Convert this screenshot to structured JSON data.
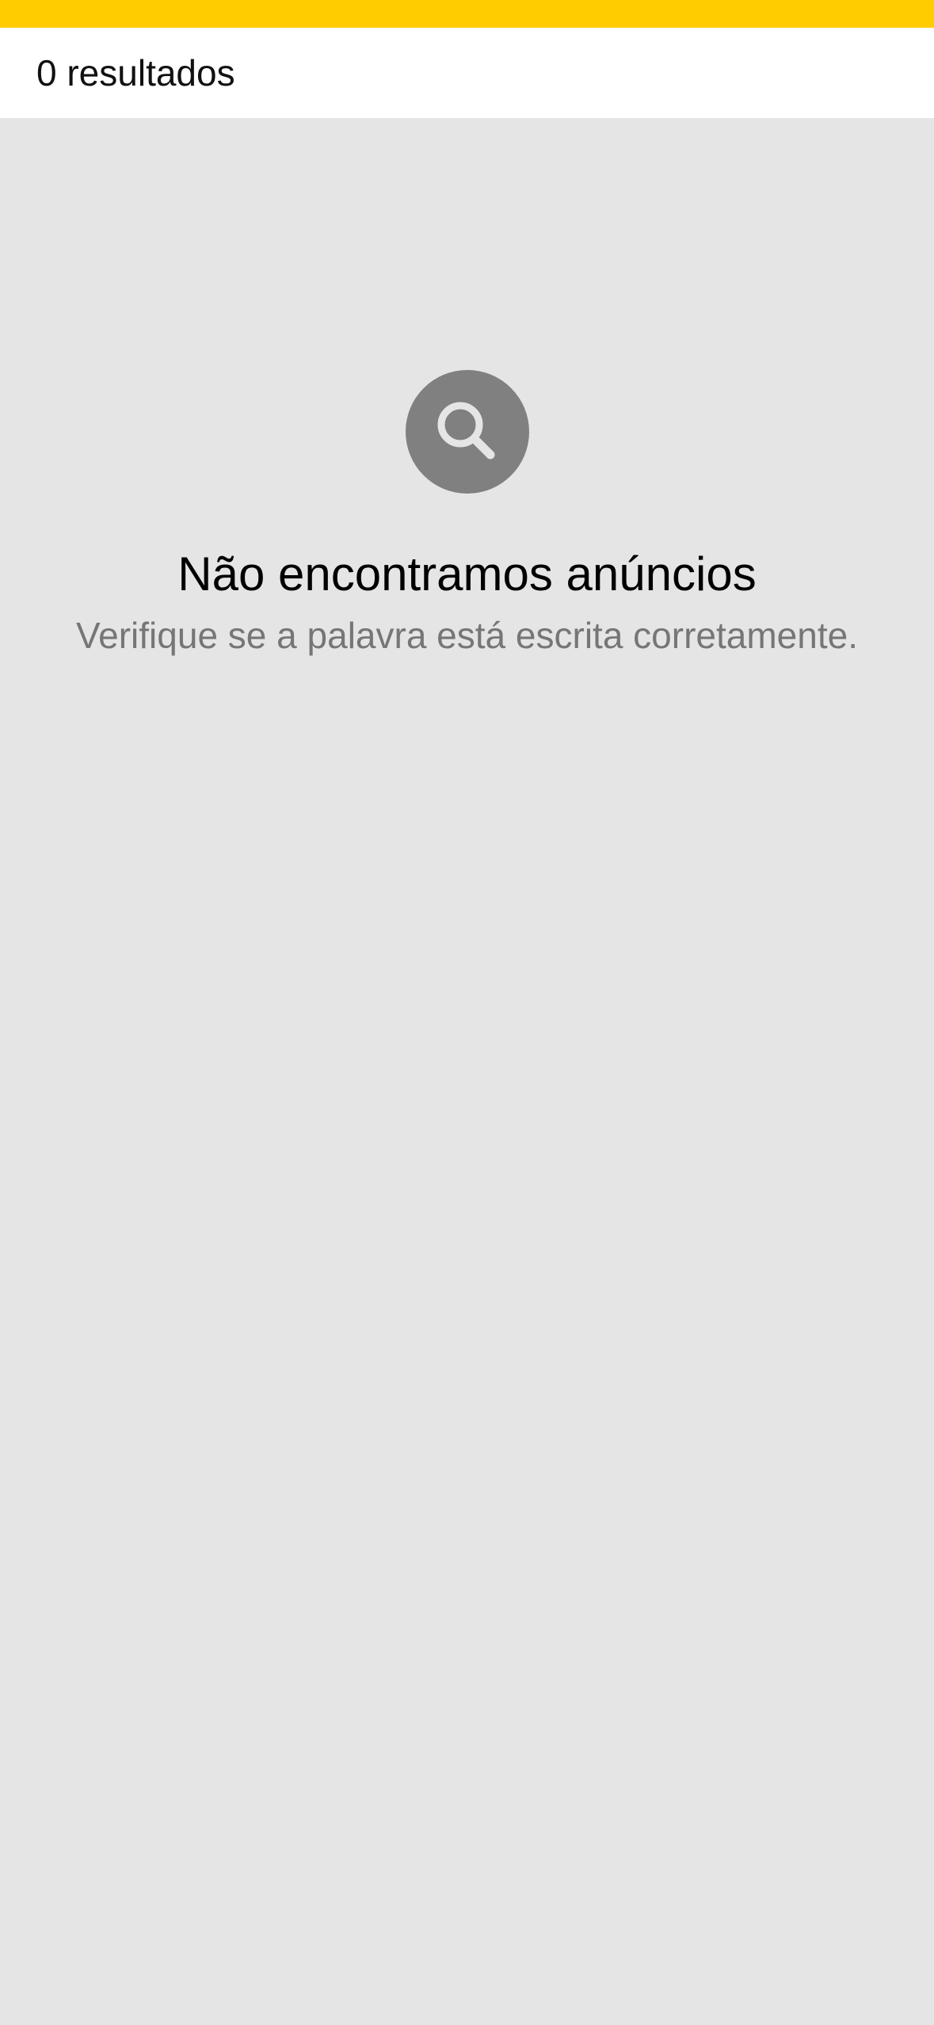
{
  "header": {
    "results_count": "0 resultados"
  },
  "empty_state": {
    "icon": "search-icon",
    "title": "Não encontramos anúncios",
    "subtitle": "Verifique se a palavra está escrita corretamente."
  },
  "colors": {
    "accent": "#ffcc00",
    "background": "#e5e5e5",
    "icon_circle": "#808080",
    "subtitle_text": "#767676"
  }
}
